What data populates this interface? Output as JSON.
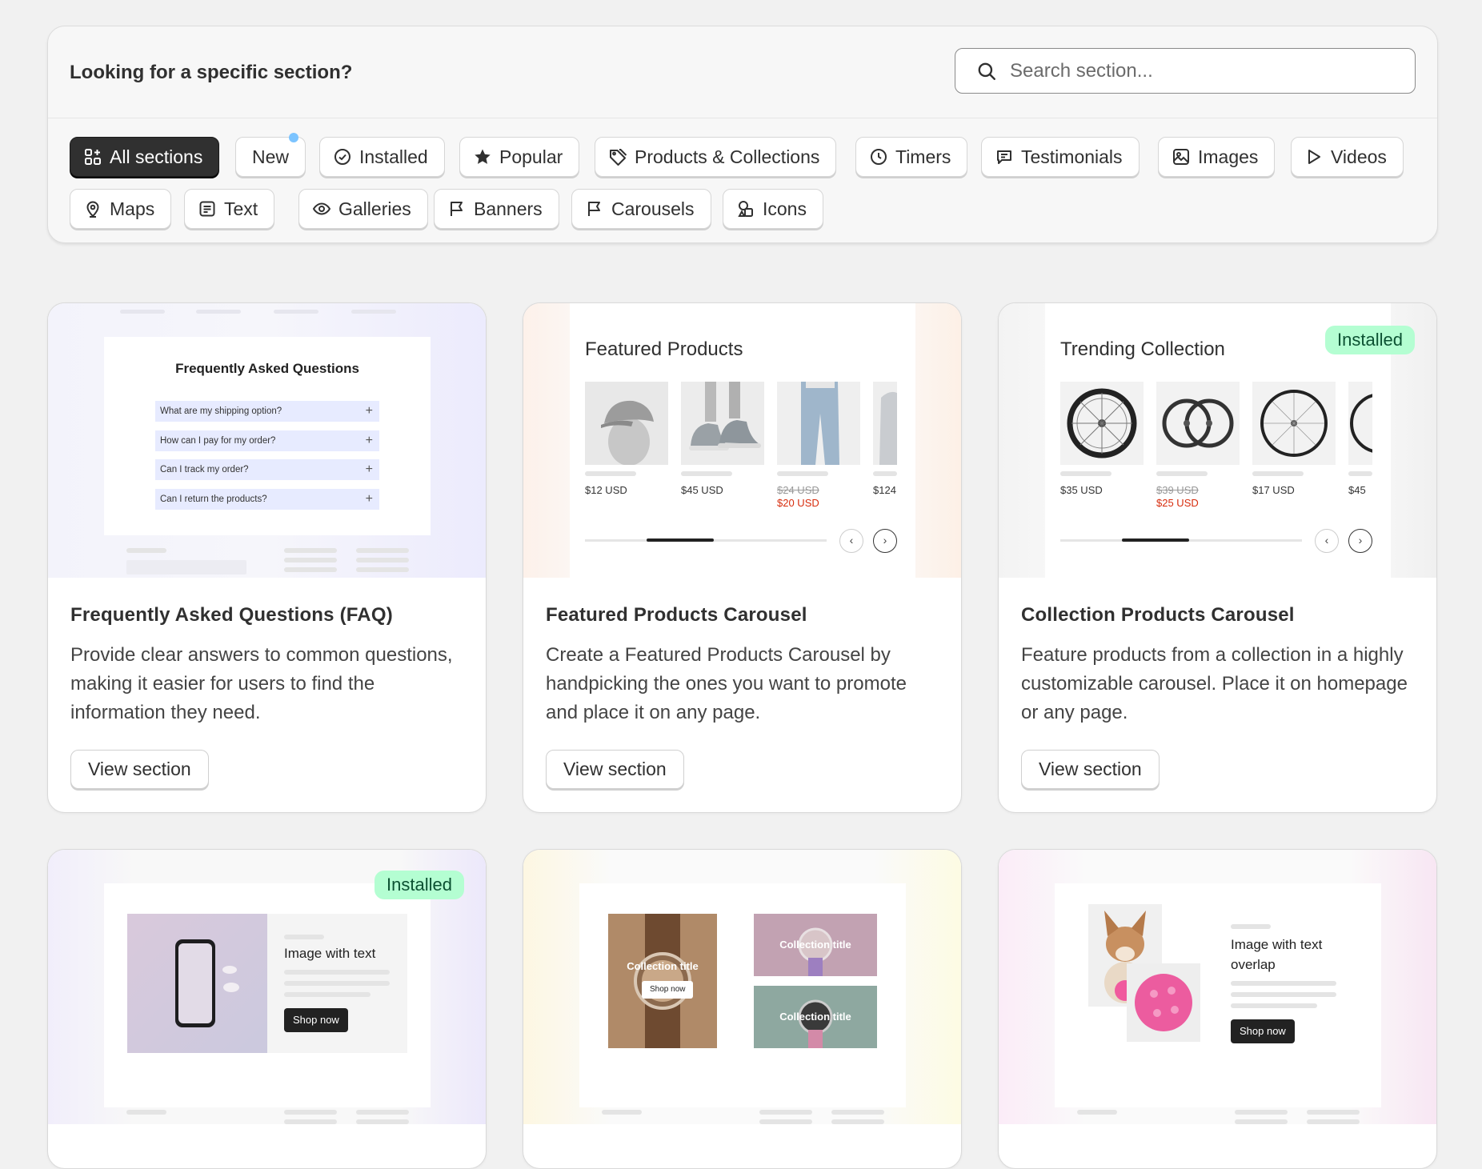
{
  "filter_panel": {
    "title": "Looking for a specific section?",
    "search": {
      "placeholder": "Search section...",
      "value": ""
    },
    "pills": [
      {
        "label": "All sections",
        "icon": "apps-icon",
        "active": true
      },
      {
        "label": "New",
        "icon": "",
        "indicator": "new-dot"
      },
      {
        "label": "Installed",
        "icon": "check-circle-icon"
      },
      {
        "label": "Popular",
        "icon": "star-icon"
      },
      {
        "label": "Products & Collections",
        "icon": "tag-icon"
      },
      {
        "label": "Timers",
        "icon": "clock-icon"
      },
      {
        "label": "Testimonials",
        "icon": "chat-icon"
      },
      {
        "label": "Images",
        "icon": "image-icon"
      },
      {
        "label": "Videos",
        "icon": "play-icon"
      },
      {
        "label": "Maps",
        "icon": "location-icon"
      },
      {
        "label": "Text",
        "icon": "text-icon"
      },
      {
        "label": "Galleries",
        "icon": "eye-icon"
      },
      {
        "label": "Banners",
        "icon": "flag-icon"
      },
      {
        "label": "Carousels",
        "icon": "flag-icon"
      },
      {
        "label": "Icons",
        "icon": "shapes-icon"
      }
    ]
  },
  "cards": [
    {
      "title": "Frequently Asked Questions (FAQ)",
      "description": "Provide clear answers to common questions, making it easier for users to find the information they need.",
      "button": "View section",
      "preview": {
        "heading": "Frequently Asked Questions",
        "questions": [
          "What are my shipping option?",
          "How can I pay for my order?",
          "Can I track my order?",
          "Can I return the products?"
        ]
      }
    },
    {
      "title": "Featured Products Carousel",
      "description": "Create a Featured Products Carousel by handpicking the ones you want to promote and place it on any page.",
      "button": "View section",
      "preview": {
        "heading": "Featured Products",
        "prices": [
          {
            "price": "$12 USD"
          },
          {
            "price": "$45 USD"
          },
          {
            "price": "$24 USD",
            "sale": "$20 USD"
          },
          {
            "price": "$124"
          }
        ]
      }
    },
    {
      "title": "Collection Products Carousel",
      "description": "Feature products from a collection in a highly customizable carousel. Place it on homepage or any page.",
      "button": "View section",
      "badge": "Installed",
      "preview": {
        "heading": "Trending Collection",
        "prices": [
          {
            "price": "$35 USD"
          },
          {
            "price": "$39 USD",
            "sale": "$25 USD"
          },
          {
            "price": "$17 USD"
          },
          {
            "price": "$45"
          }
        ]
      }
    },
    {
      "badge": "Installed",
      "preview": {
        "heading": "Image with text",
        "button": "Shop now"
      }
    },
    {
      "preview": {
        "tile1": "Collection title",
        "tile2": "Collection title",
        "tile3": "Collection title",
        "button": "Shop now"
      }
    },
    {
      "preview": {
        "heading": "Image with text overlap",
        "button": "Shop now"
      }
    }
  ],
  "colors": {
    "accent": "#303030",
    "installed_bg": "#b4fed2",
    "installed_text": "#0c5132",
    "sale": "#d72c0d",
    "new_dot": "#7cc4ff"
  }
}
